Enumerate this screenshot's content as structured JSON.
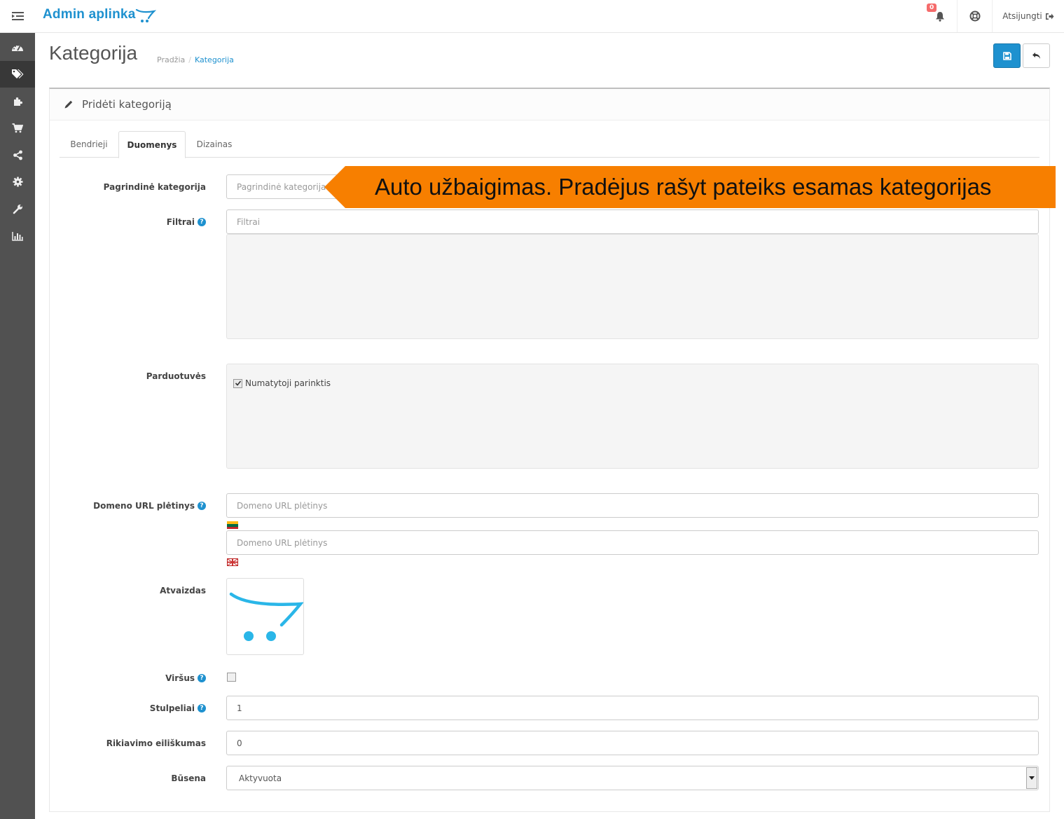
{
  "header": {
    "brand": "Admin aplinka",
    "notification_count": "0",
    "logout_label": "Atsijungti"
  },
  "sidebar": {
    "items": [
      {
        "icon": "dashboard-icon"
      },
      {
        "icon": "tags-icon",
        "active": true
      },
      {
        "icon": "puzzle-icon"
      },
      {
        "icon": "cart-icon"
      },
      {
        "icon": "share-icon"
      },
      {
        "icon": "gear-icon"
      },
      {
        "icon": "wrench-icon"
      },
      {
        "icon": "bar-chart-icon"
      }
    ]
  },
  "page": {
    "title": "Kategorija",
    "breadcrumb": [
      "Pradžia",
      "Kategorija"
    ]
  },
  "panel": {
    "heading": "Pridėti kategoriją"
  },
  "tabs": [
    "Bendrieji",
    "Duomenys",
    "Dizainas"
  ],
  "active_tab": "Duomenys",
  "form": {
    "parent": {
      "label": "Pagrindinė kategorija",
      "placeholder": "Pagrindinė kategorija"
    },
    "filters": {
      "label": "Filtrai",
      "placeholder": "Filtrai"
    },
    "stores": {
      "label": "Parduotuvės",
      "option": "Numatytoji parinktis",
      "checked": true
    },
    "seo": {
      "label": "Domeno URL plėtinys",
      "placeholder_lt": "Domeno URL plėtinys",
      "placeholder_en": "Domeno URL plėtinys"
    },
    "image": {
      "label": "Atvaizdas"
    },
    "top": {
      "label": "Viršus",
      "checked": false
    },
    "column": {
      "label": "Stulpeliai",
      "value": "1"
    },
    "sort_order": {
      "label": "Rikiavimo eiliškumas",
      "value": "0"
    },
    "status": {
      "label": "Būsena",
      "value": "Aktyvuota"
    }
  },
  "callout": {
    "text": "Auto užbaigimas. Pradėjus rašyt pateiks esamas kategorijas",
    "color": "#f77f00"
  },
  "colors": {
    "accent": "#1e91cf",
    "sidebar": "#515151"
  }
}
